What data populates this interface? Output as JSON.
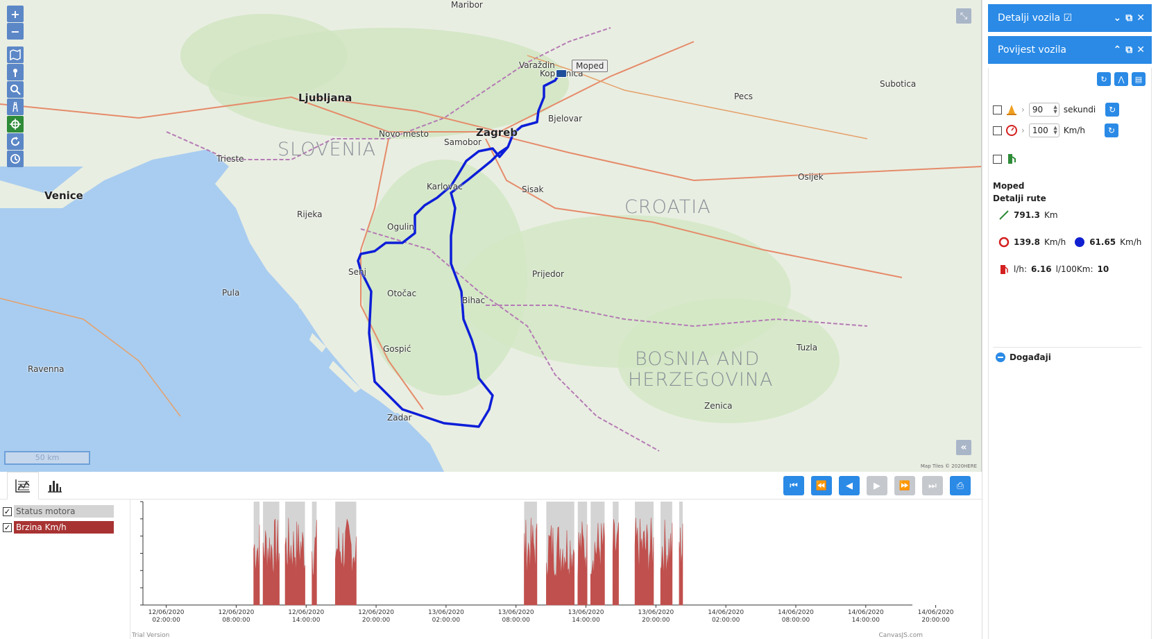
{
  "map": {
    "countries": [
      {
        "name": "SLOVENIA",
        "x": 400,
        "y": 200
      },
      {
        "name": "CROATIA",
        "x": 900,
        "y": 283
      },
      {
        "name": "BOSNIA AND",
        "x": 915,
        "y": 502
      },
      {
        "name": "HERZEGOVINA",
        "x": 905,
        "y": 532
      }
    ],
    "cities": [
      {
        "name": "Zagreb",
        "big": true
      },
      {
        "name": "Ljubljana",
        "big": true
      },
      {
        "name": "Venice",
        "big": true
      },
      {
        "name": "Rijeka"
      },
      {
        "name": "Karlovac"
      },
      {
        "name": "Samobor"
      },
      {
        "name": "Koprivnica"
      },
      {
        "name": "Varaždin"
      },
      {
        "name": "Bjelovar"
      },
      {
        "name": "Sisak"
      },
      {
        "name": "Zadar"
      },
      {
        "name": "Pula"
      },
      {
        "name": "Osijek"
      },
      {
        "name": "Bihac"
      },
      {
        "name": "Prijedor"
      },
      {
        "name": "Tuzla"
      },
      {
        "name": "Zenica"
      },
      {
        "name": "Trieste"
      },
      {
        "name": "Maribor"
      },
      {
        "name": "Pecs"
      },
      {
        "name": "Senj"
      },
      {
        "name": "Gospić"
      },
      {
        "name": "Ogulin"
      },
      {
        "name": "Otočac"
      },
      {
        "name": "Novo mesto"
      },
      {
        "name": "Ravenna"
      },
      {
        "name": "Subotica"
      }
    ],
    "vehicle_label": "Moped",
    "scale_label": "50 km",
    "attribution": "Map Tiles © 2020HERE"
  },
  "bottom": {
    "legend": [
      {
        "label": "Status motora",
        "checked": "✓",
        "bg": "#d4d4d4",
        "fg": "#555"
      },
      {
        "label": "Brzina Km/h",
        "checked": "✓",
        "bg": "#a83232",
        "fg": "#fff"
      }
    ]
  },
  "chart_data": {
    "type": "area",
    "series": [
      {
        "name": "Status motora",
        "color": "#d4d4d4"
      },
      {
        "name": "Brzina Km/h",
        "color": "#c0504d"
      }
    ],
    "x_tick_labels": [
      [
        "12/06/2020",
        "02:00:00"
      ],
      [
        "12/06/2020",
        "08:00:00"
      ],
      [
        "12/06/2020",
        "14:00:00"
      ],
      [
        "12/06/2020",
        "20:00:00"
      ],
      [
        "13/06/2020",
        "02:00:00"
      ],
      [
        "13/06/2020",
        "08:00:00"
      ],
      [
        "13/06/2020",
        "14:00:00"
      ],
      [
        "13/06/2020",
        "20:00:00"
      ],
      [
        "14/06/2020",
        "02:00:00"
      ],
      [
        "14/06/2020",
        "08:00:00"
      ],
      [
        "14/06/2020",
        "14:00:00"
      ],
      [
        "14/06/2020",
        "20:00:00"
      ]
    ],
    "engine_on_intervals_hours": [
      [
        9.5,
        10.0
      ],
      [
        10.3,
        11.7
      ],
      [
        12.2,
        13.9
      ],
      [
        14.5,
        14.9
      ],
      [
        16.5,
        18.3
      ],
      [
        32.7,
        33.8
      ],
      [
        34.6,
        37.0
      ],
      [
        37.3,
        38.1
      ],
      [
        38.4,
        39.6
      ],
      [
        40.3,
        40.8
      ],
      [
        42.2,
        43.8
      ],
      [
        44.4,
        45.4
      ],
      [
        46.0,
        46.3
      ]
    ],
    "footer_left": "Trial Version",
    "footer_right": "CanvasJS.com"
  },
  "right": {
    "panels": {
      "details_title": "Detalji vozila",
      "history_title": "Povijest vozila"
    },
    "filters": {
      "stop_value": "90",
      "stop_unit": "sekundi",
      "speed_value": "100",
      "speed_unit": "Km/h"
    },
    "vehicle": "Moped",
    "route_title": "Detalji rute",
    "distance": "791.3",
    "distance_unit": "Km",
    "max_speed": "139.8",
    "max_speed_unit": "Km/h",
    "avg_speed": "61.65",
    "avg_speed_unit": "Km/h",
    "fuel_prefix": "l/h:",
    "fuel_lh": "6.16",
    "fuel_100_label": "l/100Km:",
    "fuel_100": "10",
    "events_label": "Događaji"
  }
}
